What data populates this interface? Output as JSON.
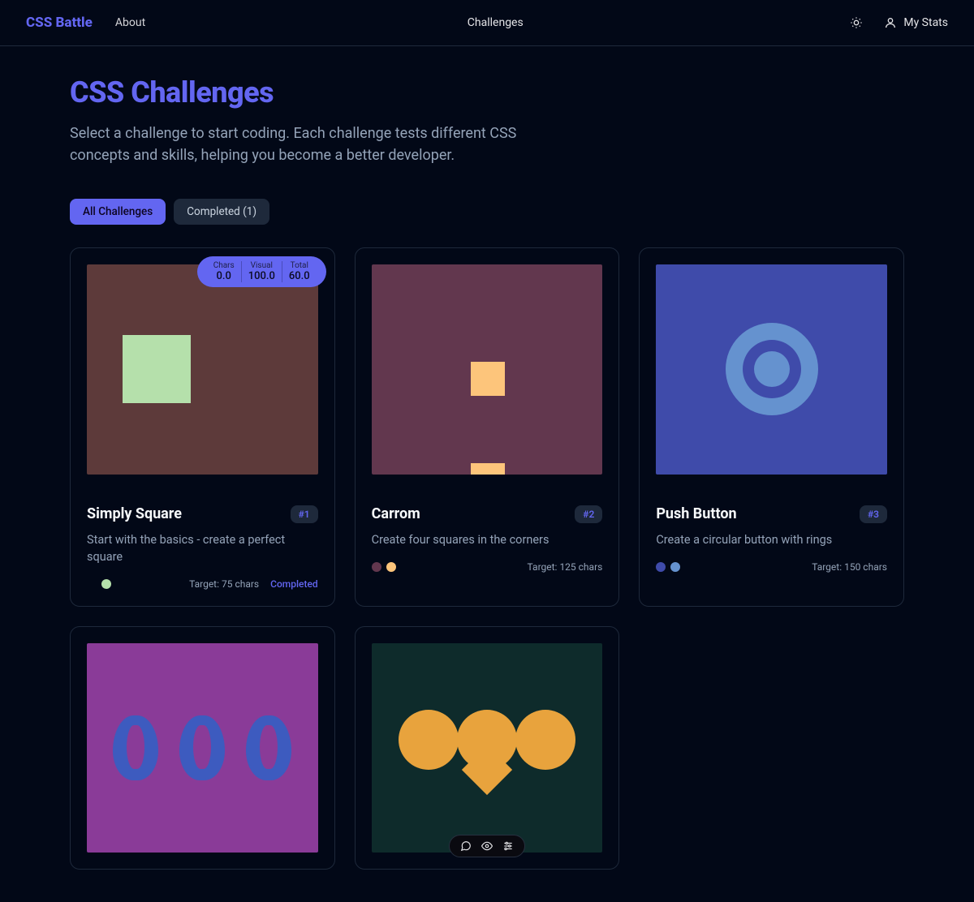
{
  "header": {
    "logo": "CSS Battle",
    "about": "About",
    "challenges": "Challenges",
    "mystats": "My Stats"
  },
  "page": {
    "title": "CSS Challenges",
    "subtitle": "Select a challenge to start coding. Each challenge tests different CSS concepts and skills, helping you become a better developer."
  },
  "tabs": {
    "all": "All Challenges",
    "completed": "Completed (1)"
  },
  "score_badge": {
    "chars_label": "Chars",
    "chars_val": "0.0",
    "visual_label": "Visual",
    "visual_val": "100.0",
    "total_label": "Total",
    "total_val": "60.0"
  },
  "cards": [
    {
      "idx": "#1",
      "title": "Simply Square",
      "desc": "Start with the basics - create a perfect square",
      "target": "Target: 75 chars",
      "completed": "Completed",
      "colors": [
        "#5d3a3a",
        "#b5e0ab"
      ]
    },
    {
      "idx": "#2",
      "title": "Carrom",
      "desc": "Create four squares in the corners",
      "target": "Target: 125 chars",
      "colors": [
        "#62374e",
        "#fdc57b"
      ]
    },
    {
      "idx": "#3",
      "title": "Push Button",
      "desc": "Create a circular button with rings",
      "target": "Target: 150 chars",
      "colors": [
        "#3f4baa",
        "#6592CF"
      ]
    }
  ]
}
